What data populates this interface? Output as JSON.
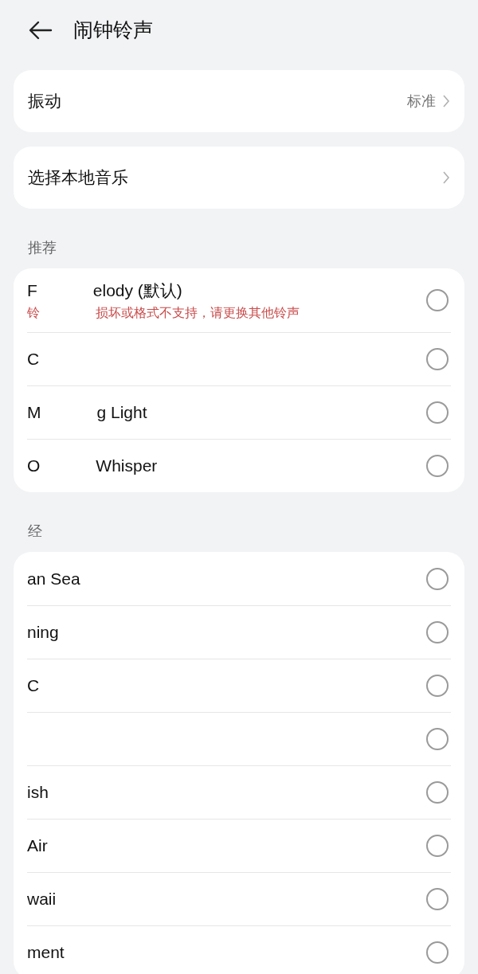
{
  "header": {
    "title": "闹钟铃声"
  },
  "settings": [
    {
      "label": "振动",
      "value": "标准"
    },
    {
      "label": "选择本地音乐"
    }
  ],
  "sections": [
    {
      "title_parts": [
        "推荐"
      ],
      "items": [
        {
          "title_parts": [
            "F",
            "elody (默认)"
          ],
          "error_parts": [
            "铃",
            "损坏或格式不支持，请更换其他铃声"
          ],
          "selected": false
        },
        {
          "title_parts": [
            "C"
          ],
          "selected": false
        },
        {
          "title_parts": [
            "M",
            "g Light"
          ],
          "selected": false
        },
        {
          "title_parts": [
            "O",
            "Whisper"
          ],
          "selected": false
        }
      ]
    },
    {
      "title_parts": [
        "经"
      ],
      "items": [
        {
          "title_parts": [
            "an Sea"
          ],
          "selected": false
        },
        {
          "title_parts": [
            "ning"
          ],
          "selected": false
        },
        {
          "title_parts": [
            "C"
          ],
          "selected": false
        },
        {
          "selected": false
        },
        {
          "title_parts": [
            "ish"
          ],
          "selected": false
        },
        {
          "title_parts": [
            "Air"
          ],
          "selected": false
        },
        {
          "title_parts": [
            "waii"
          ],
          "selected": false
        },
        {
          "title_parts": [
            "ment"
          ],
          "selected": false
        }
      ]
    }
  ]
}
